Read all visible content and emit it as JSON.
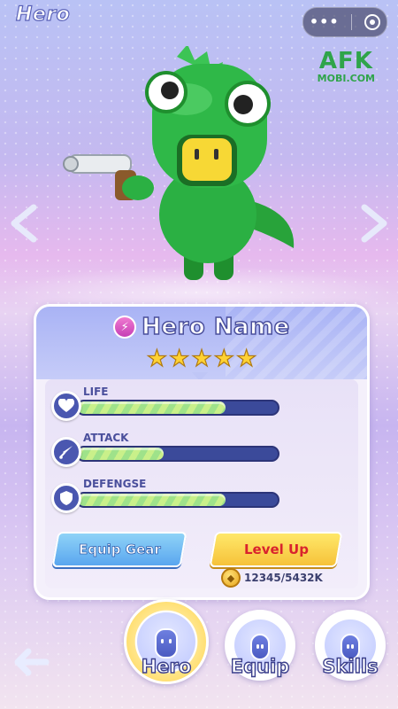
{
  "header": {
    "title": "Hero"
  },
  "capsule": {
    "menu_icon": "more-dots-icon",
    "target_icon": "target-icon"
  },
  "watermark": {
    "big": "AFK",
    "small": "MOBI.COM"
  },
  "hero": {
    "name": "Hero Name",
    "class_icon": "running-figure-icon",
    "stars": [
      "★",
      "★",
      "★",
      "★",
      "★"
    ],
    "star_count": 5
  },
  "stats": [
    {
      "label": "LIFE",
      "icon": "heart-icon",
      "fill": 0.74
    },
    {
      "label": "ATTACK",
      "icon": "sword-icon",
      "fill": 0.43
    },
    {
      "label": "DEFENGSE",
      "icon": "shield-icon",
      "fill": 0.74
    }
  ],
  "buttons": {
    "equip_gear": "Equip Gear",
    "level_up": "Level Up"
  },
  "currency": {
    "amount": "12345/5432K",
    "icon": "coin-icon"
  },
  "nav": {
    "back_icon": "back-arrow-icon",
    "items": [
      {
        "label": "Hero",
        "active": true
      },
      {
        "label": "Equip",
        "active": false
      },
      {
        "label": "Skills",
        "active": false
      }
    ]
  },
  "colors": {
    "accent": "#4a4f9c",
    "gold": "#ffd233",
    "bar_fill": "#c9f08a",
    "level_text": "#d9232d"
  }
}
